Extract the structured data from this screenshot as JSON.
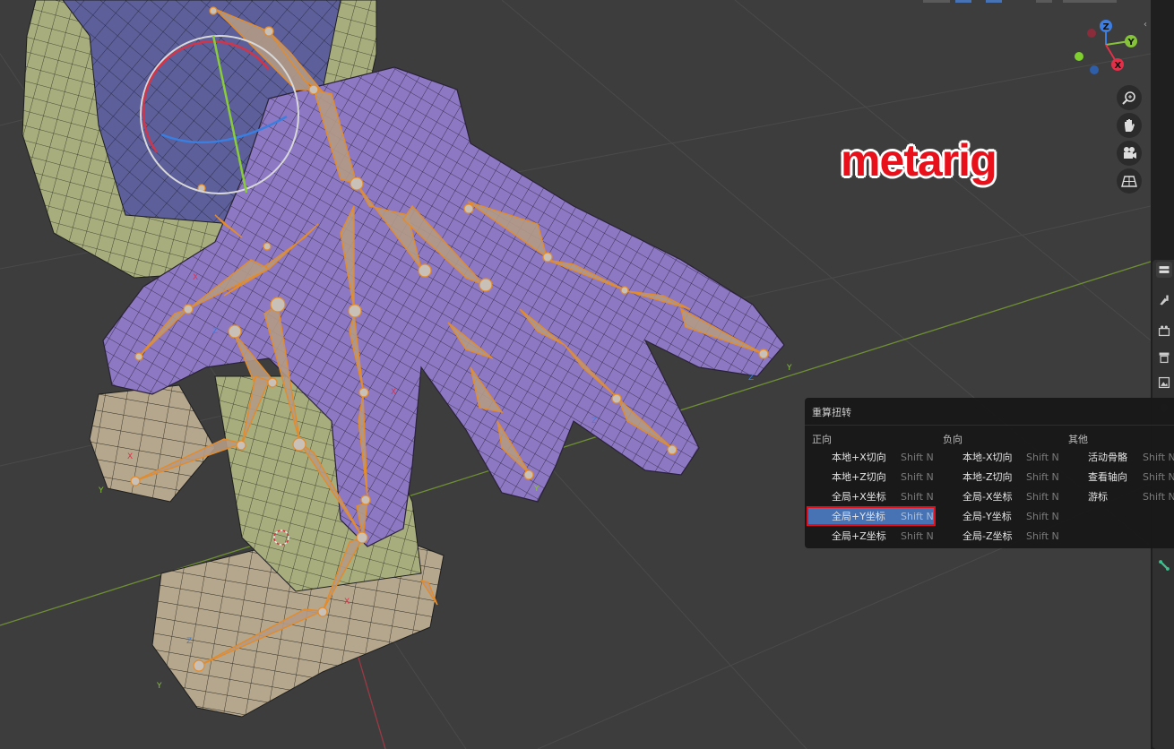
{
  "viewport": {
    "overlay_label": "metarig",
    "gizmo_axes": {
      "z": "Z",
      "y": "Y",
      "x": "X"
    },
    "axis_colors": {
      "x": "#e0304a",
      "y": "#86c33a",
      "z": "#3d7ee0"
    },
    "nav_icons": [
      "zoom-icon",
      "hand-pan-icon",
      "camera-icon",
      "grid-ortho-icon"
    ],
    "bone_letters": [
      "X",
      "Y",
      "Z"
    ]
  },
  "popup_menu": {
    "title": "重算扭转",
    "columns": [
      {
        "header": "正向",
        "items": [
          {
            "label": "本地+X切向",
            "shortcut": "Shift N"
          },
          {
            "label": "本地+Z切向",
            "shortcut": "Shift N"
          },
          {
            "label": "全局+X坐标",
            "shortcut": "Shift N"
          },
          {
            "label": "全局+Y坐标",
            "shortcut": "Shift N",
            "selected": true
          },
          {
            "label": "全局+Z坐标",
            "shortcut": "Shift N"
          }
        ]
      },
      {
        "header": "负向",
        "items": [
          {
            "label": "本地-X切向",
            "shortcut": "Shift N"
          },
          {
            "label": "本地-Z切向",
            "shortcut": "Shift N"
          },
          {
            "label": "全局-X坐标",
            "shortcut": "Shift N"
          },
          {
            "label": "全局-Y坐标",
            "shortcut": "Shift N"
          },
          {
            "label": "全局-Z坐标",
            "shortcut": "Shift N"
          }
        ]
      },
      {
        "header": "其他",
        "items": [
          {
            "label": "活动骨骼",
            "shortcut": "Shift N"
          },
          {
            "label": "查看轴向",
            "shortcut": "Shift N"
          },
          {
            "label": "游标",
            "shortcut": "Shift N"
          }
        ]
      }
    ]
  },
  "side_tabs": [
    "tool-icon",
    "render-icon",
    "output-icon",
    "view-layer-icon",
    "scene-icon",
    "world-icon",
    "bone-icon"
  ]
}
